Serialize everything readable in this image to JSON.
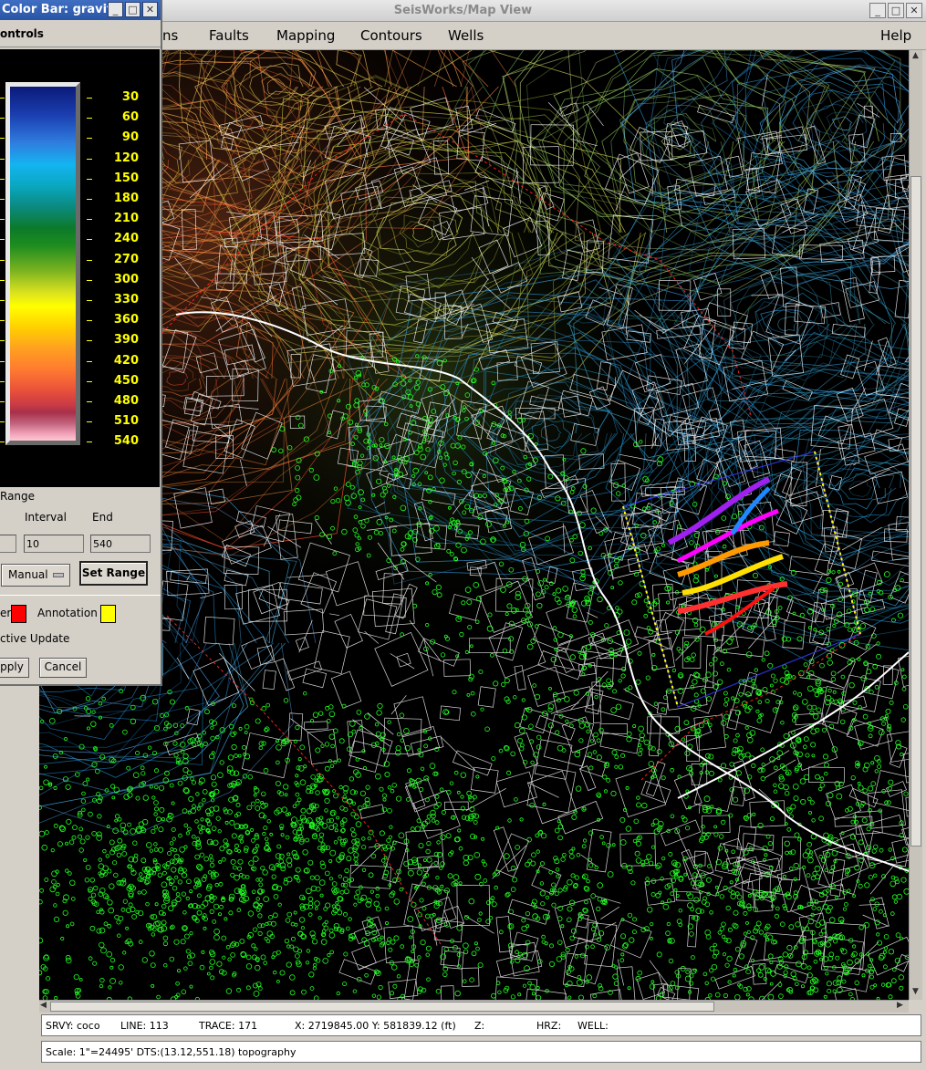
{
  "window": {
    "title": "SeisWorks/Map View"
  },
  "menu": {
    "partial": "ns",
    "faults": "Faults",
    "mapping": "Mapping",
    "contours": "Contours",
    "wells": "Wells",
    "help": "Help"
  },
  "status": {
    "srvy": "SRVY: coco",
    "line": "LINE: 113",
    "trace": "TRACE: 171",
    "xy": "X: 2719845.00 Y: 581839.12  (ft)",
    "z": "Z:",
    "hrz": "HRZ:",
    "well": "WELL:",
    "scale": "Scale: 1\"=24495' DTS:(13.12,551.18) topography"
  },
  "colorbar": {
    "title": "Color Bar: gravit",
    "controls_label": "ontrols",
    "ticks": [
      "30",
      "60",
      "90",
      "120",
      "150",
      "180",
      "210",
      "240",
      "270",
      "300",
      "330",
      "360",
      "390",
      "420",
      "450",
      "480",
      "510",
      "540"
    ],
    "range_label": "Range",
    "interval_label": "Interval",
    "end_label": "End",
    "interval_value": "10",
    "end_value": "540",
    "mode_value": "Manual",
    "set_range": "Set Range",
    "border_label": "er",
    "annotation_label": "Annotation",
    "active_update": "ctive Update",
    "apply": "pply",
    "cancel": "Cancel"
  },
  "colors": {
    "border_swatch": "#ff0000",
    "annotation_swatch": "#ffff00",
    "tick_color": "#ffff00",
    "well_color": "#22ff22"
  }
}
